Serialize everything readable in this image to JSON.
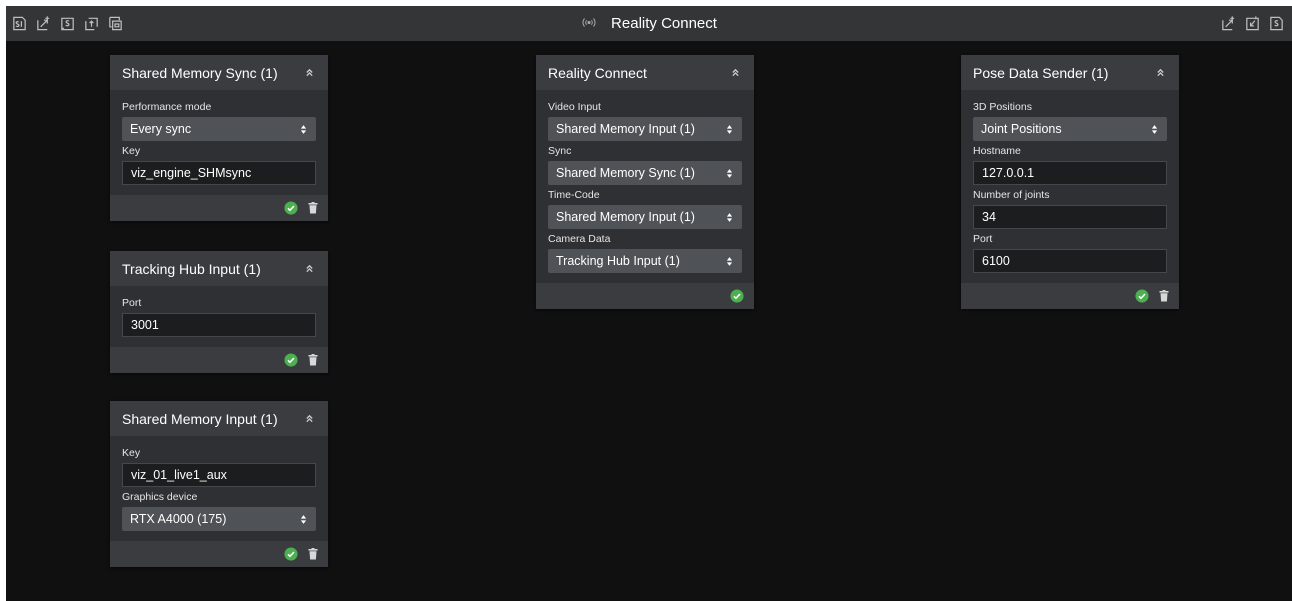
{
  "app": {
    "title": "Reality Connect"
  },
  "toolbar": {
    "left_icons": [
      "tracking-script-icon",
      "add-node-icon",
      "script-node-icon",
      "export-node-icon",
      "copy-node-icon"
    ],
    "right_icons": [
      "add-node-icon",
      "download-node-icon",
      "script-node-icon"
    ]
  },
  "panels": {
    "shm_sync": {
      "title": "Shared Memory Sync (1)",
      "fields": [
        {
          "label": "Performance mode",
          "value": "Every sync"
        },
        {
          "label": "Key",
          "value": "viz_engine_SHMsync"
        }
      ]
    },
    "tracking_hub": {
      "title": "Tracking Hub Input (1)",
      "fields": [
        {
          "label": "Port",
          "value": "3001"
        }
      ]
    },
    "shm_input": {
      "title": "Shared Memory Input (1)",
      "fields": [
        {
          "label": "Key",
          "value": "viz_01_live1_aux"
        },
        {
          "label": "Graphics device",
          "value": "RTX A4000 (175)"
        }
      ]
    },
    "reality": {
      "title": "Reality Connect",
      "fields": [
        {
          "label": "Video Input",
          "value": "Shared Memory Input (1)"
        },
        {
          "label": "Sync",
          "value": "Shared Memory Sync (1)"
        },
        {
          "label": "Time-Code",
          "value": "Shared Memory Input (1)"
        },
        {
          "label": "Camera Data",
          "value": "Tracking Hub Input (1)"
        }
      ]
    },
    "pose": {
      "title": "Pose Data Sender (1)",
      "fields": [
        {
          "label": "3D Positions",
          "value": "Joint Positions"
        },
        {
          "label": "Hostname",
          "value": "127.0.0.1"
        },
        {
          "label": "Number of joints",
          "value": "34"
        },
        {
          "label": "Port",
          "value": "6100"
        }
      ]
    }
  },
  "colors": {
    "background": "#101010",
    "topbar": "#333537",
    "panel": "#2e3033",
    "panel_header": "#3a3c3f",
    "ok_green": "#4caf50"
  }
}
